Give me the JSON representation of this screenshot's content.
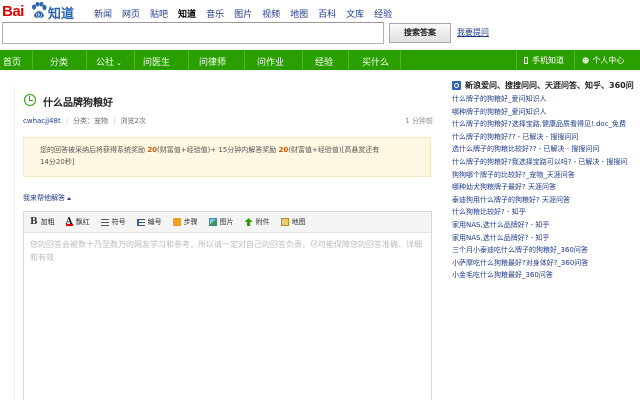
{
  "logo": {
    "bai": "Bai",
    "zhidao": "知道"
  },
  "top_nav": [
    "新闻",
    "网页",
    "贴吧",
    "知道",
    "音乐",
    "图片",
    "视频",
    "地图",
    "百科",
    "文库",
    "经验"
  ],
  "top_nav_active": "知道",
  "search": {
    "value": "",
    "button_label": "搜索答案",
    "ask_link": "我要提问"
  },
  "green_nav": {
    "items": [
      "首页",
      "分类",
      "公社",
      "问医生",
      "问律师",
      "问作业",
      "经验",
      "买什么"
    ],
    "right_items": [
      "手机知道",
      "个人中心"
    ]
  },
  "question": {
    "title": "什么品牌狗粮好",
    "user": "cwhacjj48t",
    "category": "分类：宠物",
    "views": "浏览2次",
    "time": "1 分钟前"
  },
  "reward": {
    "line1_prefix": "您的回答被采纳后将获得系统奖励",
    "line1_num1": "20",
    "line1_mid": "(财富值+经验值)+ 15分钟内解答奖励",
    "line1_num2": "20",
    "line1_suffix": "(财富值+经验值)[高悬赏还有",
    "line2": "14分20秒]"
  },
  "help_link": "我来帮他解答",
  "editor": {
    "tools": [
      "加粗",
      "飘红",
      "符号",
      "编号",
      "步骤",
      "图片",
      "附件",
      "地图"
    ],
    "placeholder": "您的回答会被数十乃至数万的网友学习和参考，所以请一定对自己的回答负责，尽可能保障您的回答准确、详细和有效"
  },
  "sidebar": {
    "heading": "新浪爱问、搜搜问问、天涯问答、知乎、360问",
    "links": [
      "什么牌子的狗粮好_爱问知识人",
      "哪种牌子的狗粮好_爱问知识人",
      "什么牌子的狗粮好?选择宝路,健康品质看得见!.doc_免费",
      "什么牌子的狗粮好?? - 已解决 - 搜搜问问",
      "选什么牌子的狗粮比较好?? - 已解决 - 搜搜问问",
      "什么牌子的狗粮好?我选择宝路可以吗? - 已解决 - 搜搜问",
      "狗狗哪个牌子的比较好?_宠物_天涯问答",
      "哪种幼犬狗粮牌子最好? 天涯问答",
      "泰迪狗用什么牌子的狗粮好? 天涯问答",
      "什么狗粮比较好? - 知乎",
      "家用NAS,选什么品牌好? - 知乎",
      "家用NAS,选什么品牌好? - 知乎",
      "三个月小泰迪吃什么牌子的狗粮好_360问答",
      "小萨摩吃什么狗粮最好?对身体好?_360问答",
      "小金毛吃什么狗粮最好_360问答"
    ]
  },
  "colors": {
    "green": "#2aa000",
    "link": "#1f3a8a",
    "brand_red": "#e10602",
    "brand_blue": "#2d64b3",
    "reward_num": "#e05400"
  }
}
